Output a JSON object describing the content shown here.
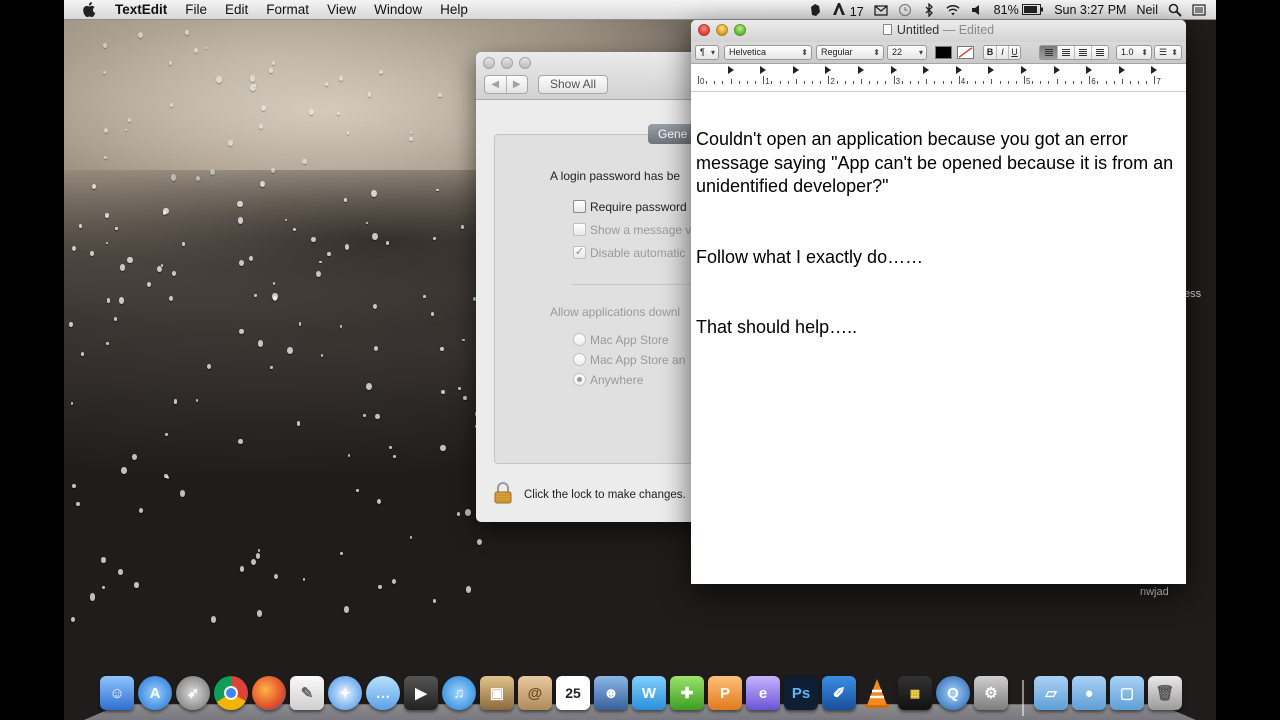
{
  "menubar": {
    "app_name": "TextEdit",
    "menus": [
      "File",
      "Edit",
      "Format",
      "View",
      "Window",
      "Help"
    ],
    "status": {
      "adobe_count": "17",
      "battery": "81%",
      "clock": "Sun 3:27 PM",
      "user": "Neil"
    }
  },
  "prefs_window": {
    "show_all": "Show All",
    "tab_label": "Gene",
    "login_text": "A login password has be",
    "require_password": "Require password",
    "show_message": "Show a message v",
    "disable_auto": "Disable automatic",
    "allow_heading": "Allow applications downl",
    "radio_app_store": "Mac App Store",
    "radio_app_store_and": "Mac App Store an",
    "radio_anywhere": "Anywhere",
    "lock_text": "Click the lock to make changes."
  },
  "textedit": {
    "title": "Untitled",
    "title_suffix": "— Edited",
    "font_family": "Helvetica",
    "font_style": "Regular",
    "font_size": "22",
    "line_spacing": "1.0",
    "style_labels": {
      "bold": "B",
      "italic": "I",
      "underline": "U"
    },
    "ruler_numbers": [
      "0",
      "1",
      "2",
      "3",
      "4",
      "5",
      "6",
      "7"
    ],
    "paragraphs": [
      "Couldn't open an application because you got an error message saying \"App can't be opened because it is from an unidentified developer?\"",
      "Follow what I exactly do……",
      "That should help….."
    ]
  },
  "desktop": {
    "side_text_1": "ess",
    "side_text_2": "nwjad"
  },
  "dock": {
    "calendar_day": "25",
    "photoshop_label": "Ps"
  }
}
